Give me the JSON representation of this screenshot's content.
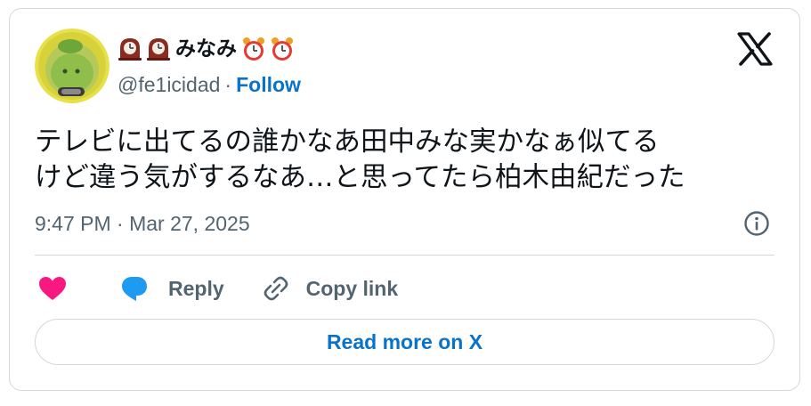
{
  "author": {
    "display_name": "みなみ",
    "handle": "@fe1icidad",
    "separator": "·",
    "follow_label": "Follow"
  },
  "tweet": {
    "text_lines": [
      "テレビに出てるの誰かなあ田中みな実かなぁ似てる",
      "けど違う気がするなあ…と思ってたら柏木由紀だった"
    ],
    "timestamp": "9:47 PM · Mar 27, 2025"
  },
  "actions": {
    "reply_label": "Reply",
    "copy_link_label": "Copy link"
  },
  "read_more_label": "Read more on X",
  "icons": {
    "name_prefix": [
      "mantelpiece-clock-icon",
      "mantelpiece-clock-icon"
    ],
    "name_suffix": [
      "alarm-clock-icon",
      "alarm-clock-icon"
    ],
    "brand": "x-logo-icon",
    "info": "info-icon",
    "like": "heart-icon",
    "reply": "speech-bubble-icon",
    "copy": "link-icon"
  },
  "colors": {
    "like": "#f91880",
    "reply": "#1d9bf0",
    "link": "#0a73c9",
    "secondary_text": "#536471",
    "border": "#cfd9de"
  }
}
